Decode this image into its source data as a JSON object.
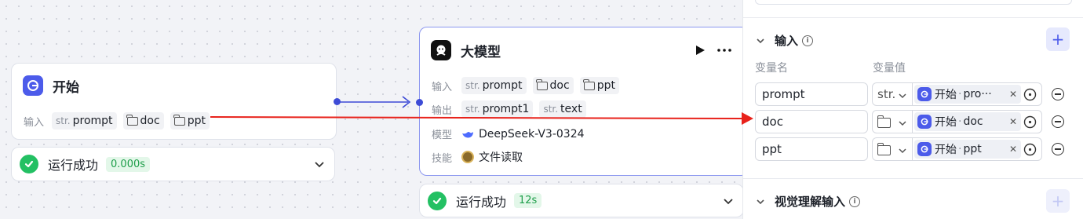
{
  "start_node": {
    "title": "开始",
    "input_label": "输入",
    "inputs": [
      {
        "type": "str.",
        "name": "prompt"
      },
      {
        "type": "folder",
        "name": "doc"
      },
      {
        "type": "folder",
        "name": "ppt"
      }
    ],
    "status": {
      "text": "运行成功",
      "time": "0.000s"
    }
  },
  "llm_node": {
    "title": "大模型",
    "input_label": "输入",
    "inputs": [
      {
        "type": "str.",
        "name": "prompt"
      },
      {
        "type": "folder",
        "name": "doc"
      },
      {
        "type": "folder",
        "name": "ppt"
      }
    ],
    "output_label": "输出",
    "outputs": [
      {
        "type": "str.",
        "name": "prompt1"
      },
      {
        "type": "str.",
        "name": "text"
      }
    ],
    "model_label": "模型",
    "model": "DeepSeek-V3-0324",
    "skill_label": "技能",
    "skill": "文件读取",
    "status": {
      "text": "运行成功",
      "time": "12s"
    }
  },
  "panel": {
    "input_section": {
      "title": "输入",
      "col_name": "变量名",
      "col_value": "变量值",
      "rows": [
        {
          "name": "prompt",
          "type": "str.",
          "ref_node": "开始",
          "ref_var": "pro···"
        },
        {
          "name": "doc",
          "type": "folder",
          "ref_node": "开始",
          "ref_var": "doc"
        },
        {
          "name": "ppt",
          "type": "folder",
          "ref_node": "开始",
          "ref_var": "ppt"
        }
      ]
    },
    "vision_section": {
      "title": "视觉理解输入"
    }
  },
  "colors": {
    "accent": "#4c5bea",
    "success": "#23c063",
    "edge": "#3d4bd6",
    "annotation_arrow": "#e8221b"
  },
  "icons": [
    "start-node-icon",
    "llm-node-icon",
    "play-icon",
    "more-icon",
    "deepseek-icon",
    "file-read-skill-icon",
    "check-icon",
    "chevron-down-icon",
    "info-icon",
    "plus-icon",
    "folder-icon",
    "close-icon",
    "target-icon",
    "minus-circle-icon"
  ]
}
